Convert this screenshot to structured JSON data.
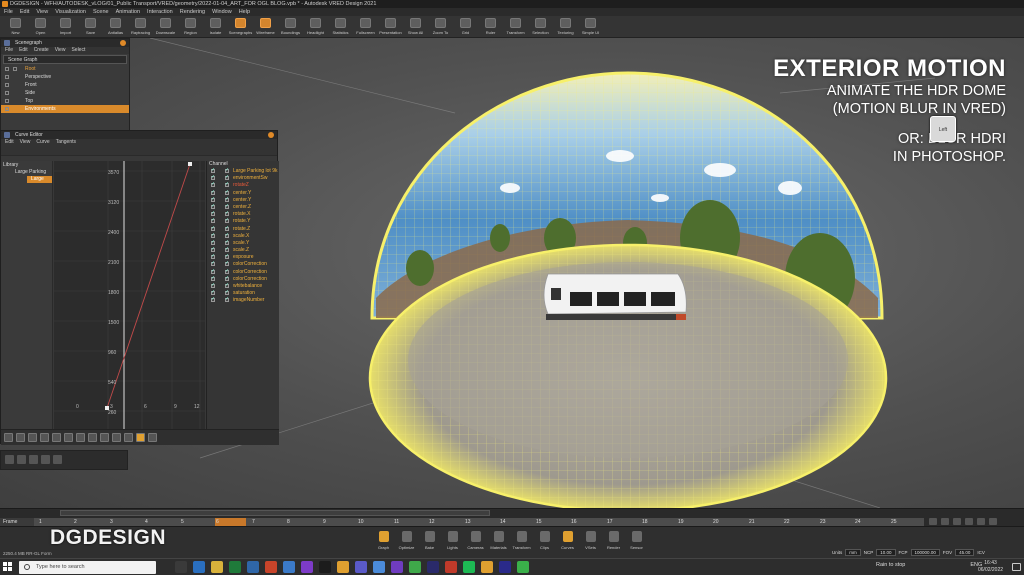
{
  "window": {
    "title": "DGDESIGN - WFH/AUTODESK_vLOG/01_Public Transport/VRED/geometry/2022-01-04_ART_FOR OGL BLOG.vpb * - Autodesk VRED Design 2021"
  },
  "menu": [
    "File",
    "Edit",
    "View",
    "Visualization",
    "Scene",
    "Animation",
    "Interaction",
    "Rendering",
    "Window",
    "Help"
  ],
  "toolbar": [
    "New",
    "Open",
    "Import",
    "Save",
    "Antialias",
    "Raytracing",
    "Downscale",
    "Region",
    "Isolate",
    "Scenegraphs",
    "Wireframe",
    "Boundings",
    "Headlight",
    "Statistics",
    "Fullscreen",
    "Presentation",
    "Show All",
    "Zoom To",
    "Grid",
    "Ruler",
    "Transform",
    "Selection",
    "Texturing",
    "Simple UI"
  ],
  "overlay": {
    "title": "EXTERIOR MOTION",
    "line1": "ANIMATE THE HDR DOME",
    "line2": "(MOTION BLUR IN VRED)",
    "line3": "OR: BLUR HDRI",
    "line4": "IN PHOTOSHOP.",
    "viewcube": "Left"
  },
  "scenegraph": {
    "title": "Scenegraph",
    "menu": [
      "File",
      "Edit",
      "Create",
      "View",
      "Select"
    ],
    "dropdown": "Scene Graph",
    "rows": [
      "Root",
      "Perspective",
      "Front",
      "Side",
      "Top",
      "Environments"
    ]
  },
  "curve_editor": {
    "title": "Curve Editor",
    "menu": [
      "Edit",
      "View",
      "Curve",
      "Tangents"
    ],
    "library_label": "Library",
    "library_rows": [
      "Large Parking",
      "Large"
    ],
    "channel_label": "Channel",
    "channels": [
      "Large Parking lot 9k",
      "environmentSw",
      "rotateZ",
      "center.Y",
      "center.Y",
      "center.Z",
      "rotate.X",
      "rotate.Y",
      "rotate.Z",
      "scale.X",
      "scale.Y",
      "scale.Z",
      "exposure",
      "colorCorrection",
      "colorCorrection",
      "colorCorrection",
      "whitebalance",
      "saturation",
      "imageNumber"
    ],
    "y_ticks": [
      "3570",
      "3120",
      "2400",
      "2100",
      "1800",
      "1500",
      "960",
      "540",
      "260"
    ],
    "x_ticks": [
      "0",
      "3",
      "6",
      "9",
      "12"
    ]
  },
  "timeline": {
    "frame_label": "Frame",
    "ticks": [
      "1",
      "2",
      "3",
      "4",
      "5",
      "6",
      "7",
      "8",
      "9",
      "10",
      "11",
      "12",
      "13",
      "14",
      "15",
      "16",
      "17",
      "18",
      "19",
      "20",
      "21",
      "22",
      "23",
      "24",
      "25"
    ],
    "start": "1",
    "end": "25",
    "current": "1"
  },
  "dock": [
    "Graph",
    "Optimize",
    "Bake",
    "Lights",
    "Cameras",
    "Materials",
    "Transform",
    "Clips",
    "Curves",
    "VSets",
    "Render",
    "Sensor"
  ],
  "status": {
    "memory": "2250.4 MB  RR-GL  Form",
    "units": "Units",
    "units_val": "mm",
    "ncp_label": "NCP",
    "ncp": "10.00",
    "fcp_label": "FCP",
    "fcp": "100000.00",
    "fov_label": "FOV",
    "fov": "45.00",
    "icv": "ICV"
  },
  "watermark": "DGDESIGN",
  "taskbar": {
    "search": "Type here to search",
    "tray_text": "Rain to stop",
    "lang": "ENG",
    "time": "16:43",
    "date": "06/02/2022"
  }
}
